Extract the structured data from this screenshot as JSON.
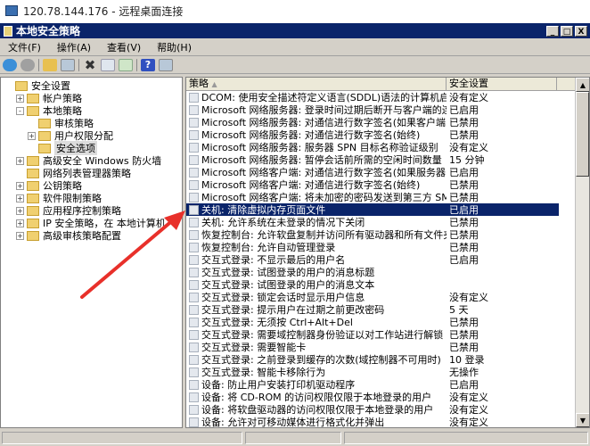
{
  "rdp_title": "120.78.144.176 - 远程桌面连接",
  "window_title": "本地安全策略",
  "window_controls": [
    "_",
    "□",
    "X"
  ],
  "menu": [
    "文件(F)",
    "操作(A)",
    "查看(V)",
    "帮助(H)"
  ],
  "toolbar": [
    "back-icon",
    "forward-icon",
    "up-icon",
    "show-hide-tree-icon",
    "delete-icon",
    "properties-icon",
    "export-icon",
    "help-icon",
    "view-icon"
  ],
  "tree": [
    {
      "label": "安全设置",
      "level": 0,
      "expander": ""
    },
    {
      "label": "帐户策略",
      "level": 1,
      "expander": "+"
    },
    {
      "label": "本地策略",
      "level": 1,
      "expander": "-"
    },
    {
      "label": "审核策略",
      "level": 2,
      "expander": ""
    },
    {
      "label": "用户权限分配",
      "level": 2,
      "expander": "+"
    },
    {
      "label": "安全选项",
      "level": 2,
      "expander": "",
      "selected": true
    },
    {
      "label": "高级安全 Windows 防火墙",
      "level": 1,
      "expander": "+"
    },
    {
      "label": "网络列表管理器策略",
      "level": 1,
      "expander": ""
    },
    {
      "label": "公钥策略",
      "level": 1,
      "expander": "+"
    },
    {
      "label": "软件限制策略",
      "level": 1,
      "expander": "+"
    },
    {
      "label": "应用程序控制策略",
      "level": 1,
      "expander": "+"
    },
    {
      "label": "IP 安全策略，在 本地计算机",
      "level": 1,
      "expander": "+"
    },
    {
      "label": "高级审核策略配置",
      "level": 1,
      "expander": "+"
    }
  ],
  "columns": [
    "策略",
    "安全设置"
  ],
  "rows": [
    [
      "DCOM: 使用安全描述符定义语言(SDDL)语法的计算机启动限制",
      "没有定义"
    ],
    [
      "Microsoft 网络服务器: 登录时间过期后断开与客户端的连接",
      "已启用"
    ],
    [
      "Microsoft 网络服务器: 对通信进行数字签名(如果客户端...",
      "已禁用"
    ],
    [
      "Microsoft 网络服务器: 对通信进行数字签名(始终)",
      "已禁用"
    ],
    [
      "Microsoft 网络服务器: 服务器 SPN 目标名称验证级别",
      "没有定义"
    ],
    [
      "Microsoft 网络服务器: 暂停会话前所需的空闲时间数量",
      "15 分钟"
    ],
    [
      "Microsoft 网络客户端: 对通信进行数字签名(如果服务器...",
      "已启用"
    ],
    [
      "Microsoft 网络客户端: 对通信进行数字签名(始终)",
      "已禁用"
    ],
    [
      "Microsoft 网络客户端: 将未加密的密码发送到第三方 SM...",
      "已禁用"
    ],
    [
      "关机: 清除虚拟内存页面文件",
      "已启用"
    ],
    [
      "关机: 允许系统在未登录的情况下关闭",
      "已禁用"
    ],
    [
      "恢复控制台: 允许软盘复制并访问所有驱动器和所有文件夹",
      "已禁用"
    ],
    [
      "恢复控制台: 允许自动管理登录",
      "已禁用"
    ],
    [
      "交互式登录: 不显示最后的用户名",
      "已启用"
    ],
    [
      "交互式登录: 试图登录的用户的消息标题",
      ""
    ],
    [
      "交互式登录: 试图登录的用户的消息文本",
      ""
    ],
    [
      "交互式登录: 锁定会话时显示用户信息",
      "没有定义"
    ],
    [
      "交互式登录: 提示用户在过期之前更改密码",
      "5 天"
    ],
    [
      "交互式登录: 无须按 Ctrl+Alt+Del",
      "已禁用"
    ],
    [
      "交互式登录: 需要域控制器身份验证以对工作站进行解锁",
      "已禁用"
    ],
    [
      "交互式登录: 需要智能卡",
      "已禁用"
    ],
    [
      "交互式登录: 之前登录到缓存的次数(域控制器不可用时)",
      "10 登录"
    ],
    [
      "交互式登录: 智能卡移除行为",
      "无操作"
    ],
    [
      "设备: 防止用户安装打印机驱动程序",
      "已启用"
    ],
    [
      "设备: 将 CD-ROM 的访问权限仅限于本地登录的用户",
      "没有定义"
    ],
    [
      "设备: 将软盘驱动器的访问权限仅限于本地登录的用户",
      "没有定义"
    ],
    [
      "设备: 允许对可移动媒体进行格式化并弹出",
      "没有定义"
    ]
  ],
  "selected_row": 9,
  "colors": {
    "title_bar": "#0a246a",
    "selection": "#0a246a",
    "arrow": "#e8302a"
  }
}
